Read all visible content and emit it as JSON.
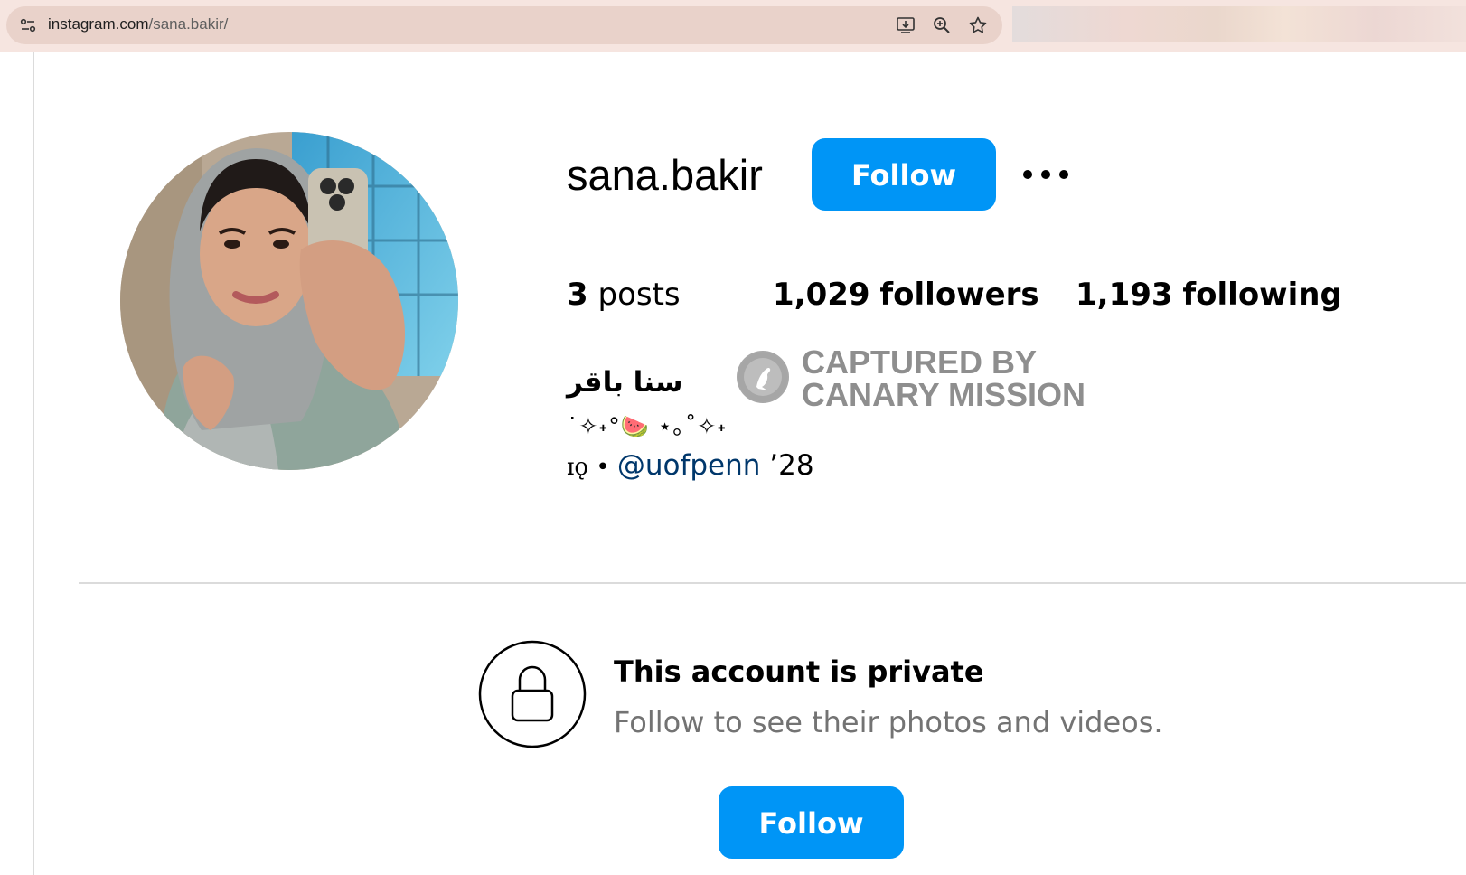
{
  "browser": {
    "url_domain": "instagram.com",
    "url_path": "/sana.bakir/",
    "icons": [
      "site-info-icon",
      "install-app-icon",
      "zoom-icon",
      "bookmark-star-icon"
    ]
  },
  "profile": {
    "username": "sana.bakir",
    "follow_label": "Follow",
    "more_icon": "more-options-icon",
    "stats": {
      "posts_count": "3",
      "posts_label": "posts",
      "followers_count": "1,029",
      "followers_label": "followers",
      "following_count": "1,193",
      "following_label": "following"
    },
    "full_name": "سنا باقر",
    "bio_emoji_line": "˙✧˖°🍉 ⋆｡˚✧˖",
    "bio_prefix": "ɪǫ • ",
    "bio_mention": "@uofpenn",
    "bio_suffix": " ’28"
  },
  "watermark": {
    "line1": "CAPTURED BY",
    "line2": "CANARY MISSION",
    "icon": "canary-bird-icon"
  },
  "private_notice": {
    "icon": "lock-icon",
    "title": "This account is private",
    "subtitle": "Follow to see their photos and videos.",
    "follow_label": "Follow"
  },
  "colors": {
    "primary_button": "#0095f6",
    "mention": "#00376b",
    "secondary_text": "#737373"
  }
}
